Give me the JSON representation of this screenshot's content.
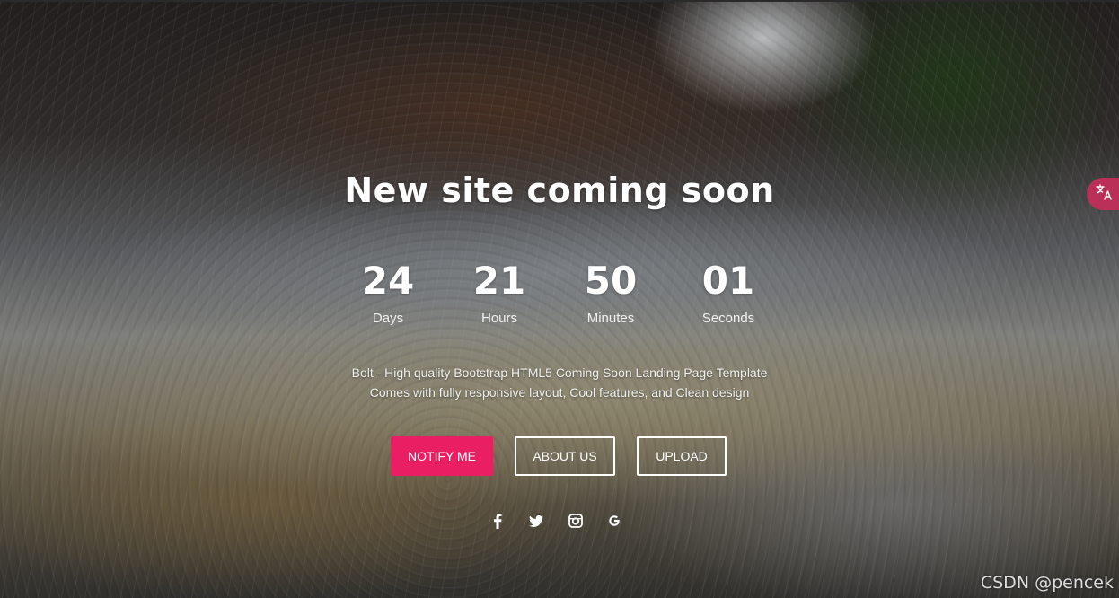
{
  "page": {
    "title": "New site coming soon"
  },
  "countdown": [
    {
      "value": "24",
      "label": "Days"
    },
    {
      "value": "21",
      "label": "Hours"
    },
    {
      "value": "50",
      "label": "Minutes"
    },
    {
      "value": "01",
      "label": "Seconds"
    }
  ],
  "description": {
    "line1": "Bolt - High quality Bootstrap HTML5 Coming Soon Landing Page Template",
    "line2": "Comes with fully responsive layout, Cool features, and Clean design"
  },
  "buttons": {
    "notify": "NOTIFY ME",
    "about": "ABOUT US",
    "upload": "UPLOAD"
  },
  "social": {
    "icons": [
      "facebook-icon",
      "twitter-icon",
      "instagram-icon",
      "google-icon"
    ]
  },
  "widget": {
    "icon": "translate-icon"
  },
  "watermark": {
    "text": "CSDN @pencek"
  },
  "colors": {
    "accent": "#e91e63",
    "text": "#ffffff"
  }
}
